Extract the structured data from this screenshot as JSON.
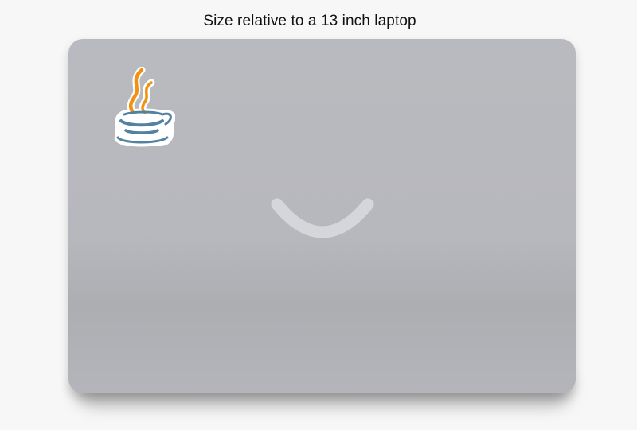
{
  "caption": "Size relative to a 13 inch laptop",
  "sticker": {
    "icon": "java-coffee-cup-icon",
    "colors": {
      "steam": "#f29111",
      "cup": "#5382a1",
      "outline": "#ffffff"
    }
  },
  "laptop": {
    "color": "#b9babf",
    "logo_color": "#d4d6da"
  }
}
